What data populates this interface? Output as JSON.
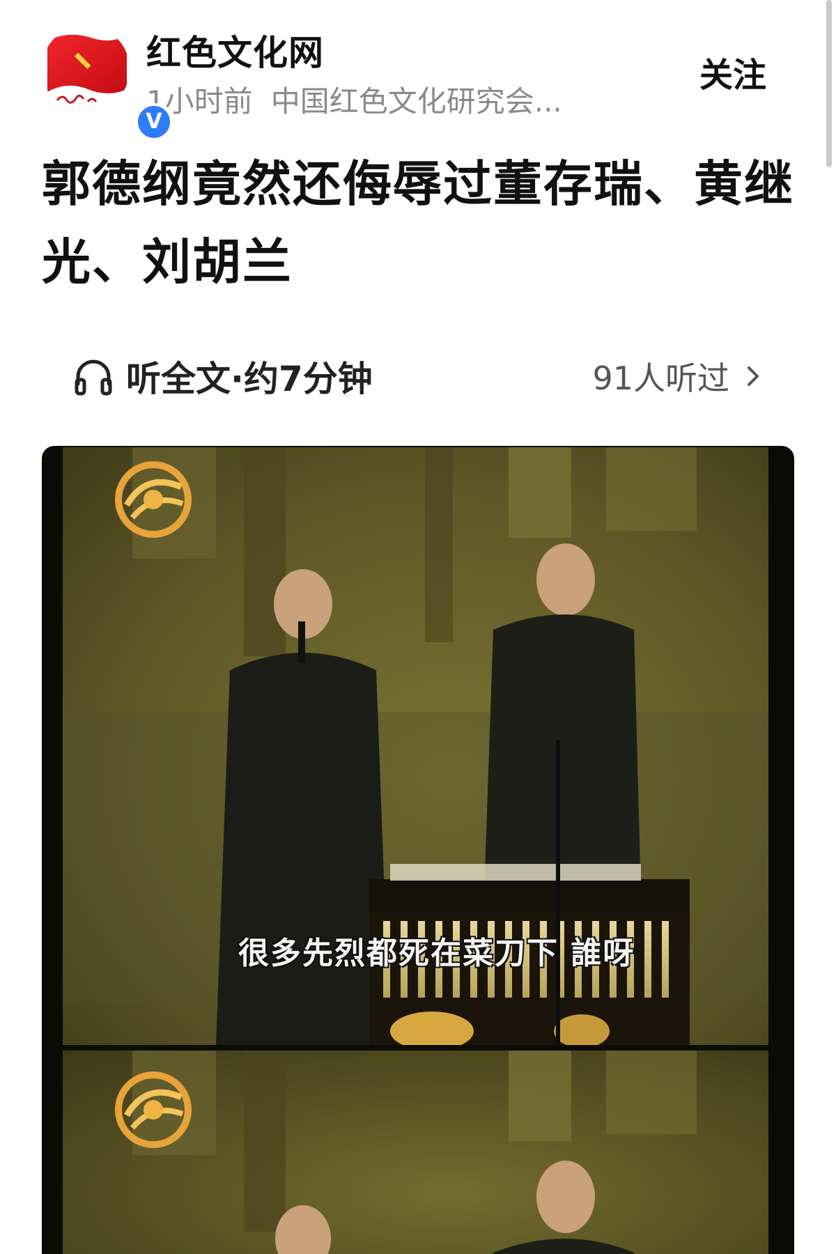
{
  "author": {
    "name": "红色文化网",
    "time_ago": "1小时前",
    "source": "中国红色文化研究会...",
    "verified_label": "V",
    "follow_label": "关注"
  },
  "article": {
    "title": "郭德纲竟然还侮辱过董存瑞、黄继光、刘胡兰"
  },
  "listen": {
    "label": "听全文·约7分钟",
    "count": "91人听过"
  },
  "media": {
    "subtitle": "很多先烈都死在菜刀下 誰呀"
  },
  "colors": {
    "avatar_red": "#d8131b",
    "verified_blue": "#2f7df6",
    "meta_gray": "#8a8a8a",
    "stage_olive": "#5c5526"
  },
  "icons": {
    "headphone": "headphone-icon",
    "chevron": "chevron-right-icon",
    "verified": "verified-badge-icon",
    "logo": "phoenix-logo-icon"
  }
}
